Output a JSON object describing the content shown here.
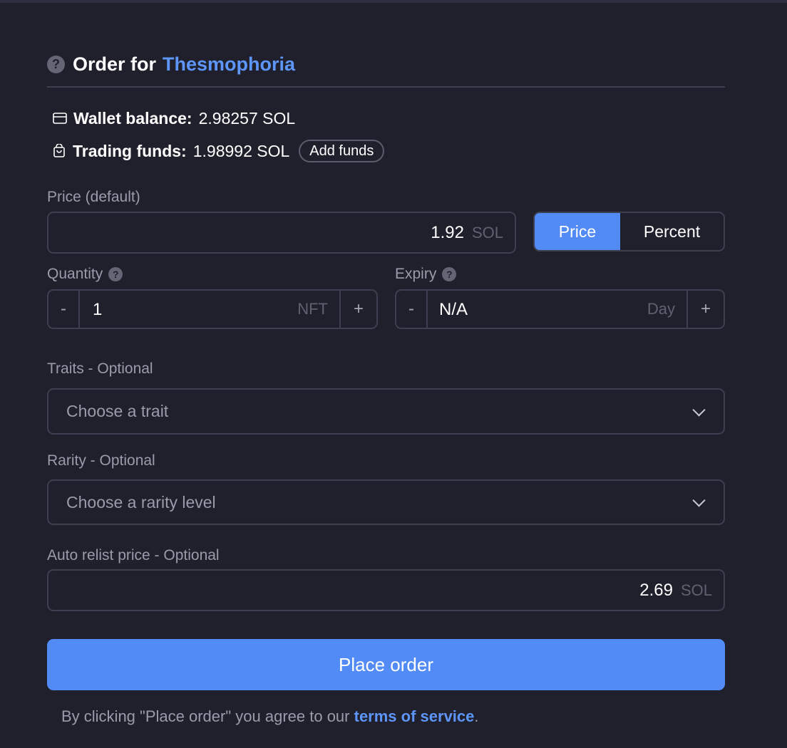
{
  "header": {
    "title_prefix": "Order for",
    "collection_name": "Thesmophoria",
    "help_icon": "question-circle-icon"
  },
  "balances": {
    "wallet_label": "Wallet balance:",
    "wallet_value": "2.98257 SOL",
    "wallet_icon": "credit-card-icon",
    "trading_label": "Trading funds:",
    "trading_value": "1.98992 SOL",
    "trading_icon": "bag-icon",
    "add_funds_label": "Add funds"
  },
  "price": {
    "label": "Price (default)",
    "value": "1.92",
    "unit": "SOL",
    "toggle": {
      "price_label": "Price",
      "percent_label": "Percent",
      "selected": "Price"
    }
  },
  "quantity": {
    "label": "Quantity",
    "minus": "-",
    "value": "1",
    "unit": "NFT",
    "plus": "+"
  },
  "expiry": {
    "label": "Expiry",
    "minus": "-",
    "value": "N/A",
    "unit": "Day",
    "plus": "+"
  },
  "traits": {
    "label": "Traits - Optional",
    "placeholder": "Choose a trait"
  },
  "rarity": {
    "label": "Rarity - Optional",
    "placeholder": "Choose a rarity level"
  },
  "relist": {
    "label": "Auto relist price - Optional",
    "value": "2.69",
    "unit": "SOL"
  },
  "submit": {
    "label": "Place order"
  },
  "footer": {
    "text_before": "By clicking \"Place order\" you agree to our",
    "link_text": "terms of service",
    "text_after": "."
  },
  "colors": {
    "background": "#1f202c",
    "accent": "#528bf6",
    "link": "#5d95f9",
    "border": "#3d3f50"
  }
}
